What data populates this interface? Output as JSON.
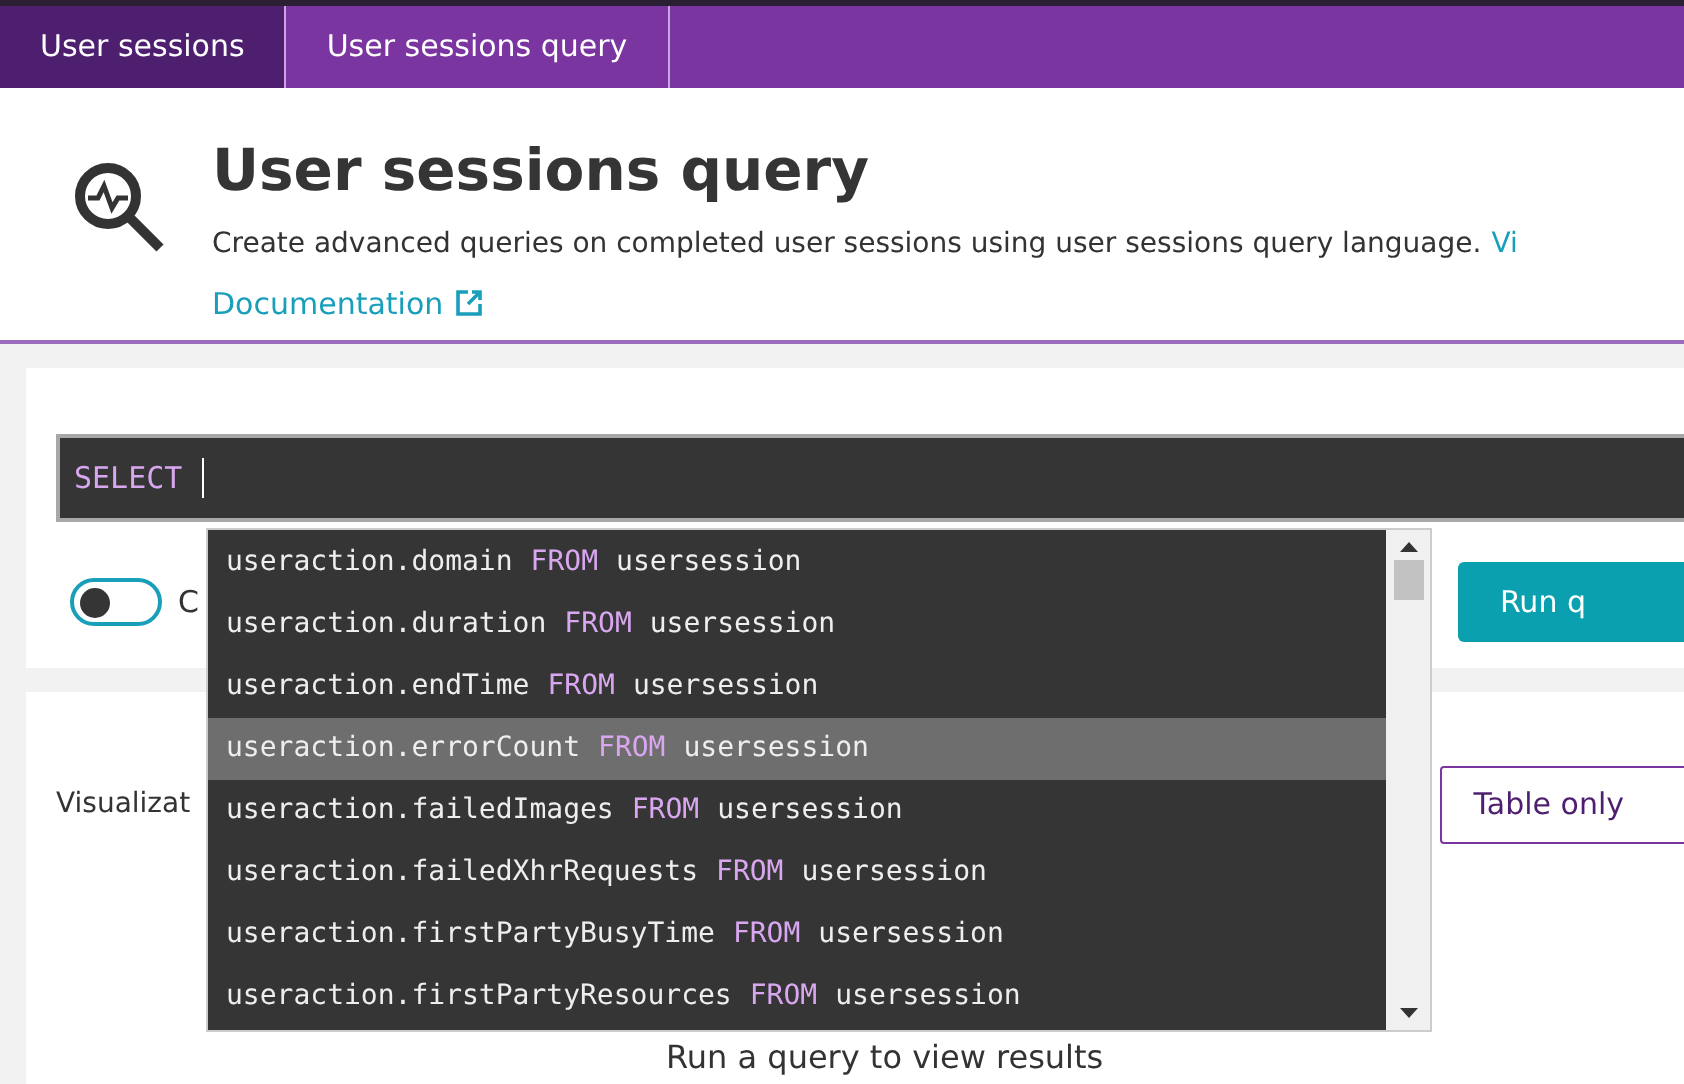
{
  "breadcrumbs": [
    {
      "label": "User sessions",
      "selected": false
    },
    {
      "label": "User sessions query",
      "selected": true
    }
  ],
  "header": {
    "title": "User sessions query",
    "description": "Create advanced queries on completed user sessions using user sessions query language.",
    "description_link": "Vi",
    "documentation_link": "Documentation"
  },
  "query_editor": {
    "keyword": "SELECT"
  },
  "toggle": {
    "label": "C",
    "on": false
  },
  "run_button": "Run q",
  "visualization": {
    "label": "Visualizat",
    "button": "Table only"
  },
  "results_message": "Run a query to view results",
  "suggestions": [
    {
      "field": "useraction.domain",
      "keyword": "FROM",
      "table": "usersession",
      "selected": false
    },
    {
      "field": "useraction.duration",
      "keyword": "FROM",
      "table": "usersession",
      "selected": false
    },
    {
      "field": "useraction.endTime",
      "keyword": "FROM",
      "table": "usersession",
      "selected": false
    },
    {
      "field": "useraction.errorCount",
      "keyword": "FROM",
      "table": "usersession",
      "selected": true
    },
    {
      "field": "useraction.failedImages",
      "keyword": "FROM",
      "table": "usersession",
      "selected": false
    },
    {
      "field": "useraction.failedXhrRequests",
      "keyword": "FROM",
      "table": "usersession",
      "selected": false
    },
    {
      "field": "useraction.firstPartyBusyTime",
      "keyword": "FROM",
      "table": "usersession",
      "selected": false
    },
    {
      "field": "useraction.firstPartyResources",
      "keyword": "FROM",
      "table": "usersession",
      "selected": false
    }
  ]
}
